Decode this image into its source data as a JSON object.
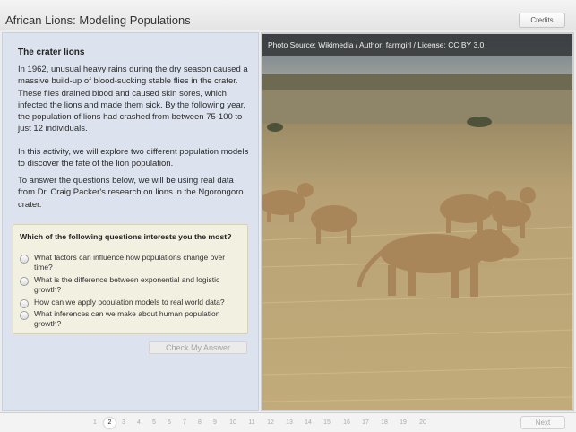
{
  "header": {
    "title": "African Lions: Modeling Populations",
    "credits_label": "Credits"
  },
  "content": {
    "section_title": "The crater lions",
    "paragraphs": [
      "In 1962, unusual heavy rains during the dry season caused a massive build-up of blood-sucking stable flies in the crater. These flies drained blood and caused skin sores, which infected the lions and made them sick. By the following year, the population of lions had crashed from between 75-100 to just 12 individuals.",
      "In this activity, we will explore two different population models to discover the fate of the lion population.",
      "To answer the questions below, we will be using real data from Dr. Craig Packer's research on lions in the Ngorongoro crater."
    ]
  },
  "question": {
    "prompt": "Which of the following questions interests you the most?",
    "options": [
      "What factors can influence how populations change over time?",
      "What is the difference between exponential and logistic growth?",
      "How can we apply population models to real world data?",
      "What inferences can we make about human population growth?"
    ],
    "check_label": "Check My Answer"
  },
  "image": {
    "credit": "Photo Source: Wikimedia / Author: farmgirl / License: CC BY 3.0"
  },
  "pagination": {
    "pages": [
      "1",
      "2",
      "3",
      "4",
      "5",
      "6",
      "7",
      "8",
      "9",
      "10",
      "11",
      "12",
      "13",
      "14",
      "15",
      "16",
      "17",
      "18",
      "19",
      "20"
    ],
    "current": "2",
    "next_label": "Next"
  },
  "colors": {
    "panel_bg": "#dde3ee",
    "question_bg": "#f2f0e1",
    "grass": "#b9a270",
    "lion": "#a9865a"
  }
}
